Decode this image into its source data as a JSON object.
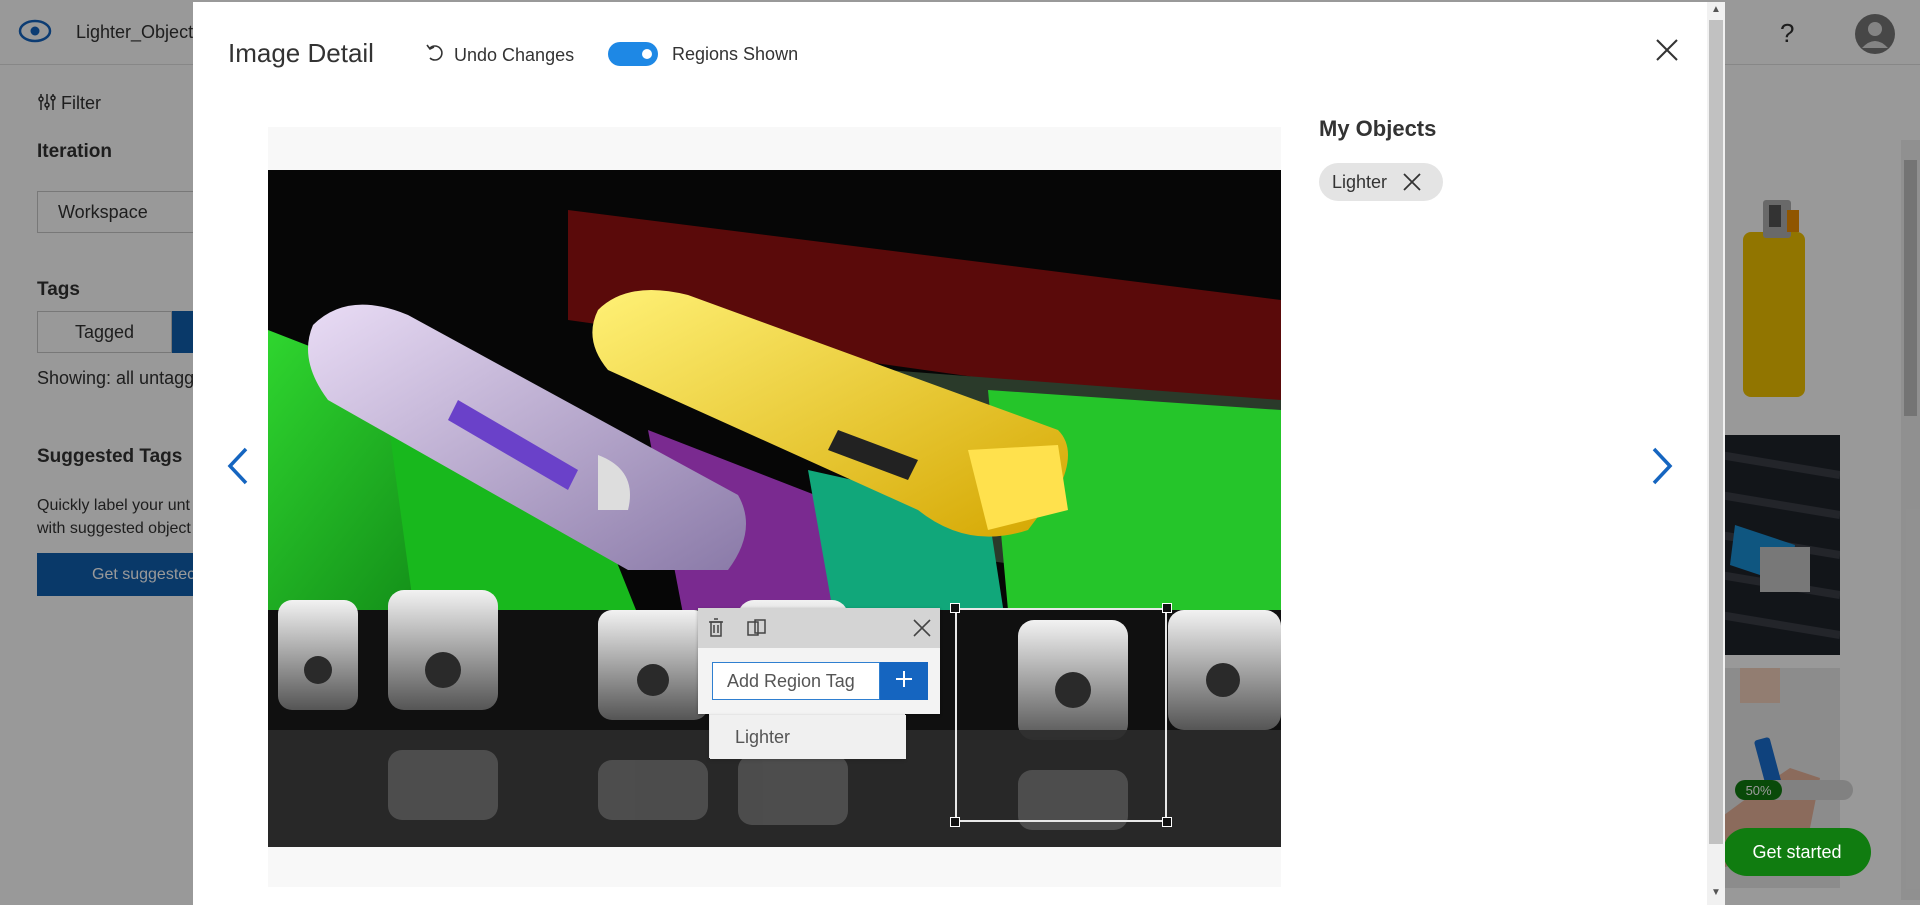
{
  "app": {
    "project_name": "Lighter_Object",
    "filter_label": "Filter",
    "iteration_heading": "Iteration",
    "iteration_value": "Workspace",
    "tags_heading": "Tags",
    "tagged_tab": "Tagged",
    "showing_text": "Showing: all untagg",
    "suggested_heading": "Suggested Tags",
    "suggested_desc_line1": "Quickly label your unt",
    "suggested_desc_line2": "with suggested object",
    "get_suggested_label": "Get suggestec",
    "help_label": "?",
    "progress_label": "50%",
    "progress_value": 0.5,
    "get_started_label": "Get started"
  },
  "modal": {
    "title": "Image Detail",
    "undo_label": "Undo Changes",
    "toggle_label": "Regions Shown",
    "toggle_on": true,
    "region_tag_placeholder": "Add Region Tag",
    "suggestion_item": "Lighter",
    "objects_heading": "My Objects",
    "object_chips": [
      "Lighter"
    ]
  },
  "icons": {
    "eye": "eye-icon",
    "filter": "filter-icon",
    "undo": "undo-icon",
    "close": "close-icon",
    "prev": "chevron-left-icon",
    "next": "chevron-right-icon",
    "trash": "trash-icon",
    "duplicate": "duplicate-icon",
    "plus": "plus-icon",
    "avatar": "avatar-icon"
  },
  "colors": {
    "accent": "#1e88e5",
    "nav_blue": "#1565c0",
    "get_started_green": "#107c10"
  }
}
